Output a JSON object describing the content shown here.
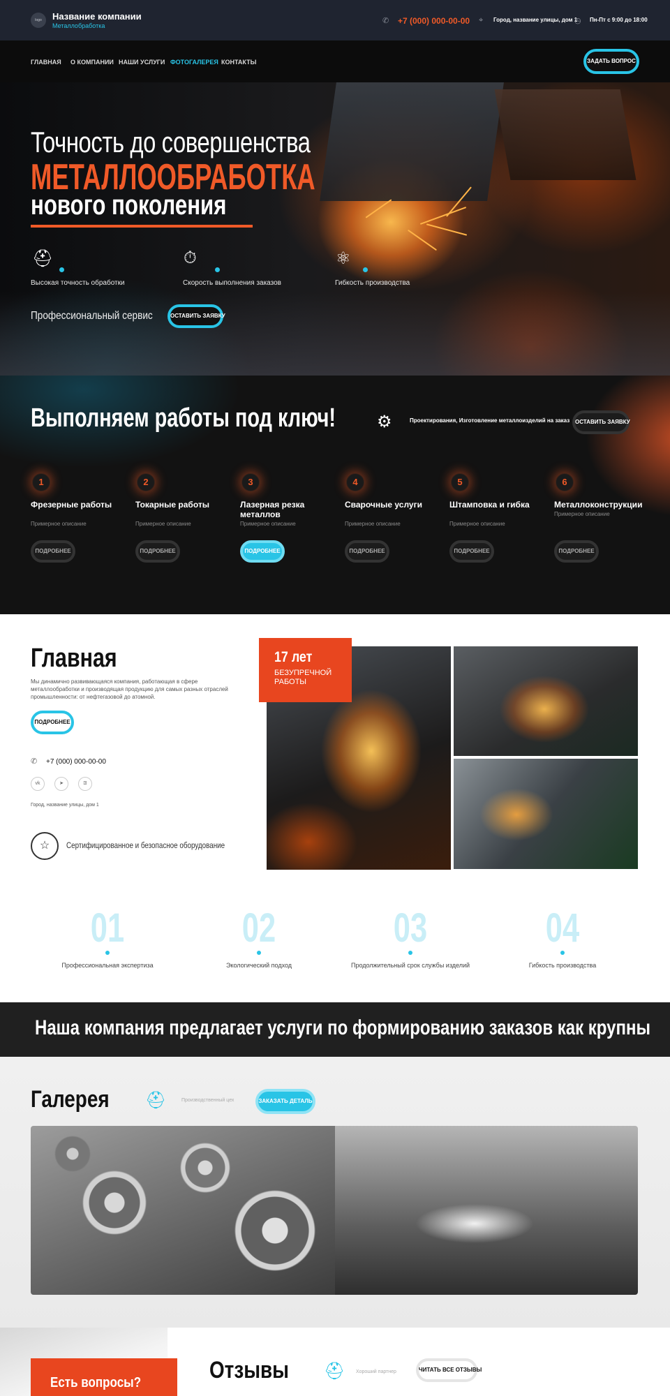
{
  "header": {
    "logo_text": "logo",
    "company_name": "Название компании",
    "company_sub": "Металлобработка",
    "phone": "+7 (000) 000-00-00",
    "address": "Город, название улицы, дом 1",
    "hours": "Пн-Пт с 9:00 до 18:00",
    "icons": {
      "phone": "phone-icon",
      "location": "location-pin-icon",
      "clock": "clock-icon"
    }
  },
  "nav": {
    "items": [
      {
        "label": "Главная",
        "active": false
      },
      {
        "label": "О компании",
        "active": false
      },
      {
        "label": "Наши услуги",
        "active": false
      },
      {
        "label": "Фотогалерея",
        "active": true
      },
      {
        "label": "Контакты",
        "active": false
      }
    ],
    "ask_button": "Задать вопрос"
  },
  "hero": {
    "line1": "Точность до совершенства",
    "line2": "МЕТАЛЛООБРАБОТКА",
    "line3": "нового поколения",
    "features": [
      {
        "label": "Высокая точность обработки",
        "icon": "worker-icon"
      },
      {
        "label": "Скорость выполнения заказов",
        "icon": "stopwatch-icon"
      },
      {
        "label": "Гибкость производства",
        "icon": "atom-icon"
      }
    ],
    "service_text": "Профессиональный сервис",
    "cta": "Оставить заявку"
  },
  "services": {
    "title": "Выполняем работы под ключ!",
    "desc": "Проектирования, Изготовление металлоизделий на заказ",
    "cta": "Оставить заявку",
    "items": [
      {
        "num": "1",
        "name": "Фрезерные работы",
        "sub": "Примерное описание",
        "button": "Подробнее",
        "active": false
      },
      {
        "num": "2",
        "name": "Токарные работы",
        "sub": "Примерное описание",
        "button": "Подробнее",
        "active": false
      },
      {
        "num": "3",
        "name": "Лазерная резка металлов",
        "sub": "Примерное описание",
        "button": "Подробнее",
        "active": true
      },
      {
        "num": "4",
        "name": "Сварочные услуги",
        "sub": "Примерное описание",
        "button": "Подробнее",
        "active": false
      },
      {
        "num": "5",
        "name": "Штамповка и гибка",
        "sub": "Примерное описание",
        "button": "Подробнее",
        "active": false
      },
      {
        "num": "6",
        "name": "Металлоконструкции",
        "sub": "Примерное описание",
        "button": "Подробнее",
        "active": false
      }
    ]
  },
  "about": {
    "title": "Главная",
    "text": "Мы динамично развивающаяся компания, работающая в сфере металлообработки и производящая продукцию для самых разных отраслей промышленности: от нефтегазовой до атомной.",
    "button": "Подробнее",
    "phone": "+7 (000) 000-00-00",
    "socials": [
      "vk",
      "telegram",
      "ok"
    ],
    "address": "Город, название улицы, дом 1",
    "cert": "Сертифицированное и безопасное оборудование",
    "badge_num": "17 лет",
    "badge_text": "безупречной работы"
  },
  "stats": [
    {
      "num": "01",
      "label": "Профессиональная экспертиза"
    },
    {
      "num": "02",
      "label": "Экологический подход"
    },
    {
      "num": "03",
      "label": "Продолжительный срок службы изделий"
    },
    {
      "num": "04",
      "label": "Гибкость производства"
    }
  ],
  "banner": {
    "text": "Наша компания предлагает услуги по формированию заказов как крупны"
  },
  "gallery": {
    "title": "Галерея",
    "sub": "Производственный цех",
    "button": "Заказать деталь"
  },
  "reviews": {
    "questions": "Есть вопросы?",
    "title": "Отзывы",
    "sub": "Хороший партнер",
    "button": "Читать все отзывы"
  },
  "colors": {
    "accent_orange": "#f05a28",
    "accent_cyan": "#29c4e6",
    "dark": "#121212"
  }
}
